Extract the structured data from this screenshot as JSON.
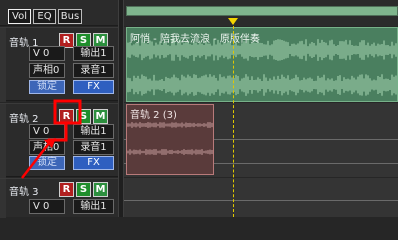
{
  "tabs": [
    {
      "label": "Vol"
    },
    {
      "label": "EQ"
    },
    {
      "label": "Bus"
    }
  ],
  "tracks": [
    {
      "name": "音轨 1",
      "volume": "V 0",
      "output": "输出1",
      "pan": "声相0",
      "input": "录音1",
      "lock": "锁定",
      "fx": "FX"
    },
    {
      "name": "音轨 2",
      "volume": "V 0",
      "output": "输出1",
      "pan": "声相0",
      "input": "录音1",
      "lock": "锁定",
      "fx": "FX"
    },
    {
      "name": "音轨 3",
      "volume": "V 0",
      "output": "输出1"
    }
  ],
  "buttons": {
    "r": "R",
    "s": "S",
    "m": "M"
  },
  "clips": [
    {
      "label": "阿悄 - 陪我去流浪 - 原版伴奏"
    },
    {
      "label": "音轨 2 (3)"
    }
  ],
  "colors": {
    "record": "#b11f1f",
    "solo": "#1f8e2c",
    "mute": "#2c8f3e",
    "clip_green": "#4a7f5f",
    "clip_red": "#5a3b3b",
    "playhead": "#f2d400",
    "annotation": "#ff0000"
  },
  "icons": {
    "marker": "playhead-marker-icon"
  }
}
